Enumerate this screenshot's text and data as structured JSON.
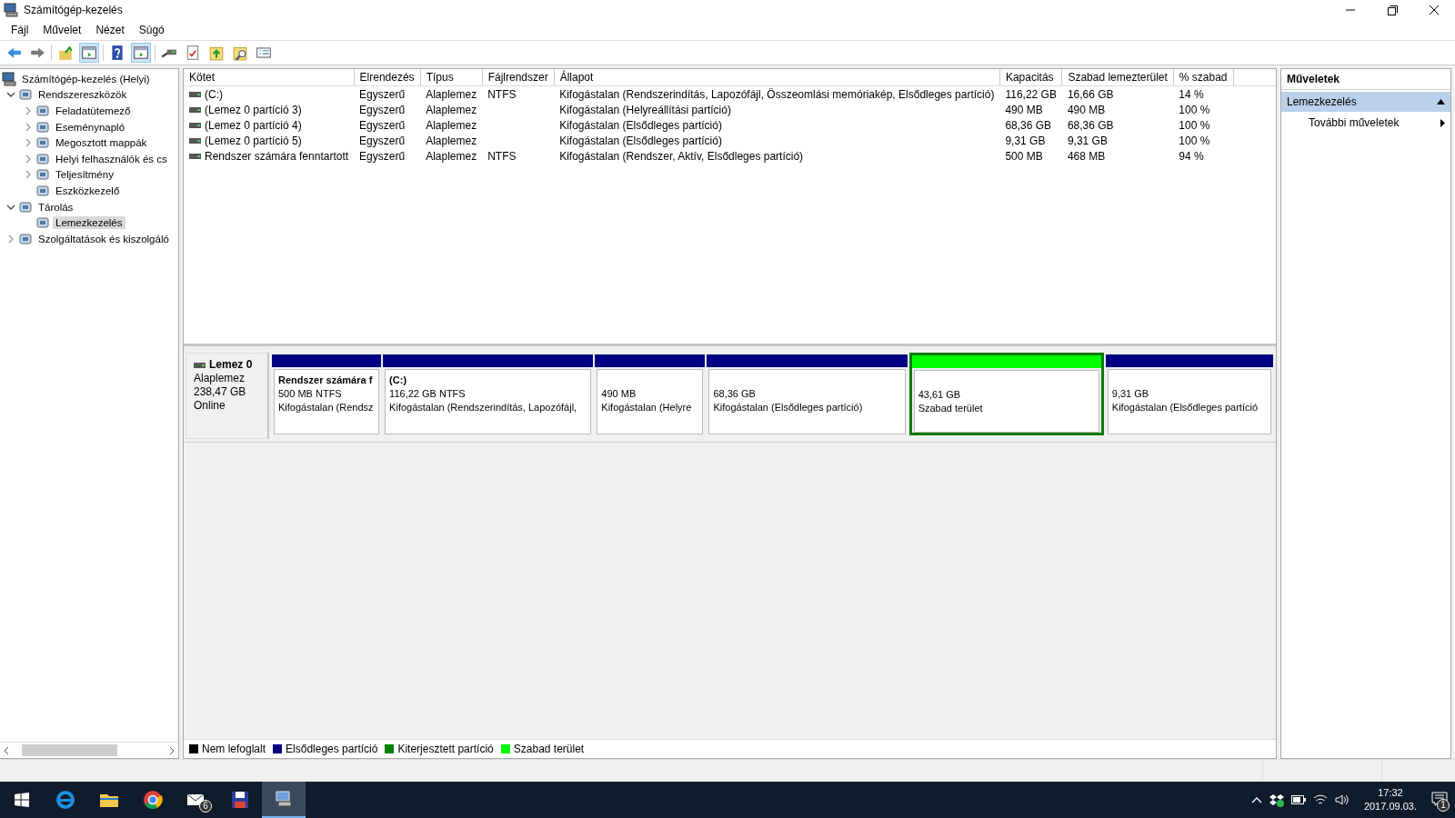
{
  "window": {
    "title": "Számítógép-kezelés"
  },
  "menu": [
    {
      "label": "Fájl"
    },
    {
      "label": "Művelet"
    },
    {
      "label": "Nézet"
    },
    {
      "label": "Súgó"
    }
  ],
  "toolbar": [
    {
      "kind": "back",
      "pressed": false
    },
    {
      "kind": "forward",
      "pressed": false
    },
    {
      "kind": "up",
      "pressed": false
    },
    {
      "kind": "pane",
      "pressed": true
    },
    {
      "kind": "help",
      "pressed": false
    },
    {
      "kind": "pane",
      "pressed": true
    },
    {
      "kind": "connect",
      "pressed": false
    },
    {
      "kind": "check",
      "pressed": false
    },
    {
      "kind": "folder-up",
      "pressed": false
    },
    {
      "kind": "folder-search",
      "pressed": false
    },
    {
      "kind": "list",
      "pressed": false
    }
  ],
  "tree": {
    "items": [
      {
        "label": "Számítógép-kezelés (Helyi)",
        "selected": false,
        "children": [
          {
            "label": "Rendszereszközök",
            "selected": false,
            "expanded": true,
            "children": [
              {
                "label": "Feladatütemező",
                "selected": false,
                "expanded": false
              },
              {
                "label": "Eseménynapló",
                "selected": false,
                "expanded": false
              },
              {
                "label": "Megosztott mappák",
                "selected": false,
                "expanded": false
              },
              {
                "label": "Helyi felhasználók és cs",
                "selected": false,
                "expanded": false
              },
              {
                "label": "Teljesítmény",
                "selected": false,
                "expanded": false
              },
              {
                "label": "Eszközkezelő",
                "selected": false
              }
            ]
          },
          {
            "label": "Tárolás",
            "selected": false,
            "expanded": true,
            "children": [
              {
                "label": "Lemezkezelés",
                "selected": true
              }
            ]
          },
          {
            "label": "Szolgáltatások és kiszolgáló",
            "selected": false,
            "expanded": false
          }
        ]
      }
    ]
  },
  "volumes": {
    "columns": [
      "Kötet",
      "Elrendezés",
      "Típus",
      "Fájlrendszer",
      "Állapot",
      "Kapacitás",
      "Szabad lemezterület",
      "% szabad"
    ],
    "rows": [
      [
        "(C:)",
        "Egyszerű",
        "Alaplemez",
        "NTFS",
        "Kifogástalan (Rendszerindítás, Lapozófájl, Összeomlási memóriakép, Elsődleges partíció)",
        "116,22 GB",
        "16,66 GB",
        "14 %"
      ],
      [
        "(Lemez 0 partíció 3)",
        "Egyszerű",
        "Alaplemez",
        "",
        "Kifogástalan (Helyreállítási partíció)",
        "490 MB",
        "490 MB",
        "100 %"
      ],
      [
        "(Lemez 0 partíció 4)",
        "Egyszerű",
        "Alaplemez",
        "",
        "Kifogástalan (Elsődleges partíció)",
        "68,36 GB",
        "68,36 GB",
        "100 %"
      ],
      [
        "(Lemez 0 partíció 5)",
        "Egyszerű",
        "Alaplemez",
        "",
        "Kifogástalan (Elsődleges partíció)",
        "9,31 GB",
        "9,31 GB",
        "100 %"
      ],
      [
        "Rendszer számára fenntartott",
        "Egyszerű",
        "Alaplemez",
        "NTFS",
        "Kifogástalan (Rendszer, Aktív, Elsődleges partíció)",
        "500 MB",
        "468 MB",
        "94 %"
      ]
    ]
  },
  "disk": {
    "name": "Lemez 0",
    "type": "Alaplemez",
    "size": "238,47 GB",
    "status": "Online",
    "partitions": [
      {
        "kind": "primary",
        "selected": false,
        "title": "Rendszer számára f",
        "lines": [
          "500 MB NTFS",
          "Kifogástalan (Rendsz"
        ]
      },
      {
        "kind": "primary",
        "selected": false,
        "title": "(C:)",
        "lines": [
          "116,22 GB NTFS",
          "Kifogástalan (Rendszerindítás, Lapozófájl,"
        ]
      },
      {
        "kind": "primary",
        "selected": false,
        "lines": [
          "490 MB",
          "Kifogástalan (Helyre"
        ]
      },
      {
        "kind": "primary",
        "selected": false,
        "lines": [
          "68,36 GB",
          "Kifogástalan (Elsődleges partíció)"
        ]
      },
      {
        "kind": "free",
        "selected": true,
        "lines": [
          "43,61 GB",
          "Szabad terület"
        ]
      },
      {
        "kind": "primary",
        "selected": false,
        "lines": [
          "9,31 GB",
          "Kifogástalan (Elsődleges partíció"
        ]
      }
    ]
  },
  "legend": [
    {
      "label": "Nem lefoglalt",
      "color": "#000000"
    },
    {
      "label": "Elsődleges partíció",
      "color": "#000080"
    },
    {
      "label": "Kiterjesztett partíció",
      "color": "#008000"
    },
    {
      "label": "Szabad terület",
      "color": "#00ff00"
    }
  ],
  "actions": {
    "title": "Műveletek",
    "section": {
      "label": "Lemezkezelés",
      "expanded": true
    },
    "items": [
      {
        "label": "További műveletek"
      }
    ]
  },
  "taskbar": {
    "apps": [
      {
        "kind": "browser",
        "selected": false
      },
      {
        "kind": "folder",
        "selected": false
      },
      {
        "kind": "globe",
        "selected": false
      },
      {
        "kind": "mail",
        "selected": false,
        "badge": "6"
      },
      {
        "kind": "floppy",
        "selected": false
      },
      {
        "kind": "computer",
        "selected": true
      }
    ],
    "time": "17:32",
    "date": "2017.09.03.",
    "notifications": "1"
  }
}
